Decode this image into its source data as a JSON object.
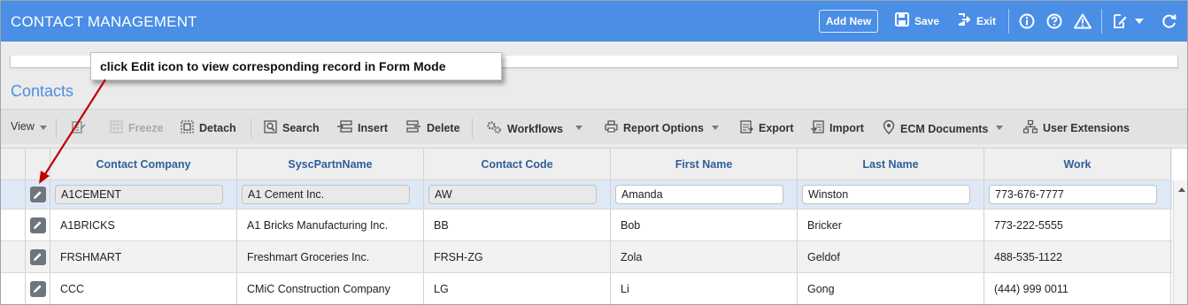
{
  "header": {
    "title": "CONTACT MANAGEMENT",
    "add_new": "Add New",
    "save": "Save",
    "exit": "Exit",
    "icons": [
      "info-icon",
      "help-icon",
      "warning-icon",
      "edit-note-icon",
      "refresh-icon"
    ]
  },
  "section": {
    "title": "Contacts"
  },
  "callout": {
    "text": "click Edit icon to view corresponding record in Form Mode"
  },
  "toolbar": {
    "view": "View",
    "freeze": "Freeze",
    "detach": "Detach",
    "search": "Search",
    "insert": "Insert",
    "delete": "Delete",
    "workflows": "Workflows",
    "report_options": "Report Options",
    "export": "Export",
    "import": "Import",
    "ecm_documents": "ECM Documents",
    "user_extensions": "User Extensions"
  },
  "grid": {
    "columns": [
      "Contact Company",
      "SyscPartnName",
      "Contact Code",
      "First Name",
      "Last Name",
      "Work"
    ],
    "rows": [
      [
        "A1CEMENT",
        "A1 Cement Inc.",
        "AW",
        "Amanda",
        "Winston",
        "773-676-7777"
      ],
      [
        "A1BRICKS",
        "A1 Bricks Manufacturing Inc.",
        "BB",
        "Bob",
        "Bricker",
        "773-222-5555"
      ],
      [
        "FRSHMART",
        "Freshmart Groceries Inc.",
        "FRSH-ZG",
        "Zola",
        "Geldof",
        "488-535-1122"
      ],
      [
        "CCC",
        "CMiC Construction Company",
        "LG",
        "Li",
        "Gong",
        "(444) 999 0011"
      ]
    ]
  },
  "colors": {
    "accent": "#4a8ee6",
    "header_text": "#2f5f99",
    "arrow": "#c00000",
    "selected_row": "#dfe9f6"
  }
}
